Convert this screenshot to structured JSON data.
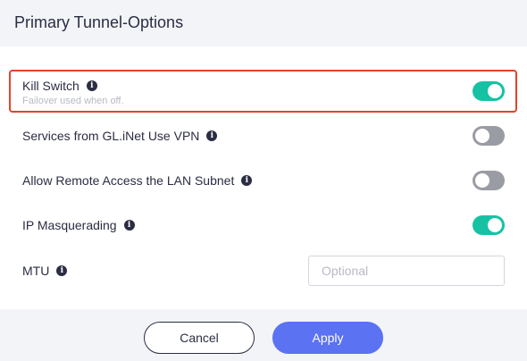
{
  "dialog": {
    "title": "Primary Tunnel-Options"
  },
  "options": [
    {
      "label": "Kill Switch",
      "sublabel": "Failover used when off.",
      "enabled": true
    },
    {
      "label": "Services from GL.iNet Use VPN",
      "enabled": false
    },
    {
      "label": "Allow Remote Access the LAN Subnet",
      "enabled": false
    },
    {
      "label": "IP Masquerading",
      "enabled": true
    }
  ],
  "mtu": {
    "label": "MTU",
    "value": "",
    "placeholder": "Optional"
  },
  "footer": {
    "cancel_label": "Cancel",
    "apply_label": "Apply"
  },
  "icons": {
    "info": "info-icon"
  },
  "colors": {
    "toggle_on": "#16c2a3",
    "toggle_off": "#9a9ca3",
    "apply_button": "#5b72f2",
    "highlight": "#e0442a"
  }
}
